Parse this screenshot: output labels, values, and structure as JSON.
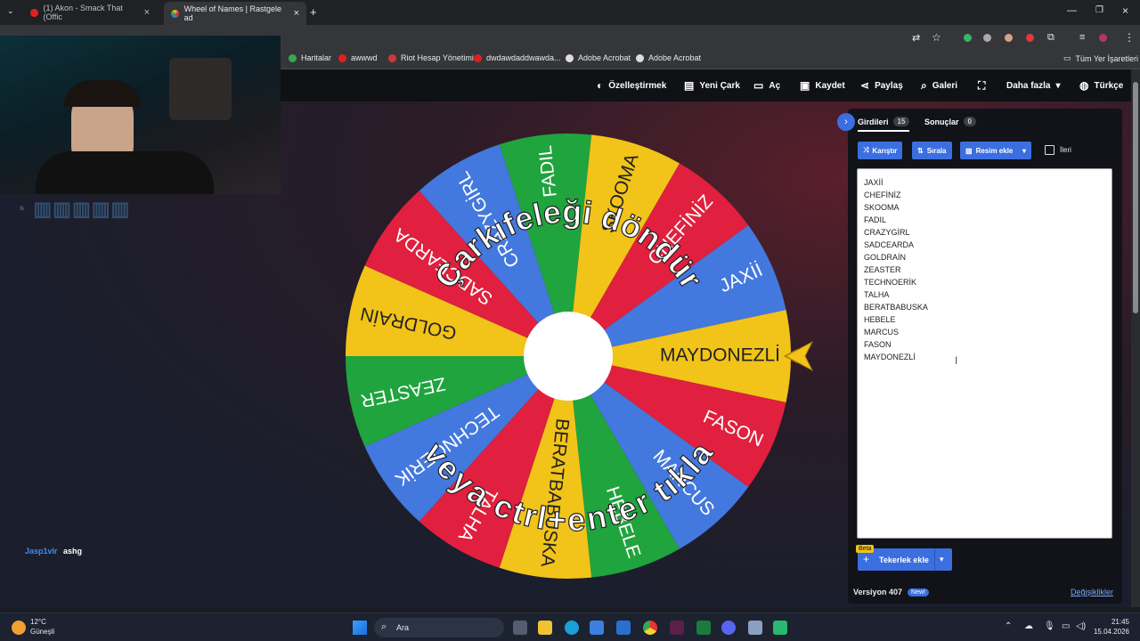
{
  "browser": {
    "tabs": [
      {
        "title": "(1) Akon - Smack That (Offic",
        "active": false
      },
      {
        "title": "Wheel of Names | Rastgele ad",
        "active": true
      }
    ],
    "bookmarks": [
      "Haritalar",
      "awwwd",
      "Riot Hesap Yönetimi",
      "dwdawdaddwawda...",
      "Adobe Acrobat",
      "Adobe Acrobat"
    ],
    "all_bookmarks": "Tüm Yer İşaretleri"
  },
  "nav": {
    "customize": "Özelleştirmek",
    "new_wheel": "Yeni Çark",
    "open": "Aç",
    "save": "Kaydet",
    "share": "Paylaş",
    "gallery": "Galeri",
    "more": "Daha fazla",
    "language": "Türkçe"
  },
  "wheel": {
    "top_text": "Çarkıfeleği döndür",
    "bottom_text": "veya ctrl+enter tıkla",
    "segments": [
      {
        "label": "MAYDONEZLİ",
        "color": "#f2c318"
      },
      {
        "label": "FASON",
        "color": "#e0203e"
      },
      {
        "label": "MARCUS",
        "color": "#4378de"
      },
      {
        "label": "HEBELE",
        "color": "#20a43e"
      },
      {
        "label": "BERATBABUSKA",
        "color": "#f2c318"
      },
      {
        "label": "TALHA",
        "color": "#e0203e"
      },
      {
        "label": "TECHNOERİK",
        "color": "#4378de"
      },
      {
        "label": "ZEASTER",
        "color": "#20a43e"
      },
      {
        "label": "GOLDRAİN",
        "color": "#f2c318"
      },
      {
        "label": "SADCEARDA",
        "color": "#e0203e"
      },
      {
        "label": "CRAZYGİRL",
        "color": "#4378de"
      },
      {
        "label": "FADIL",
        "color": "#20a43e"
      },
      {
        "label": "SKOOMA",
        "color": "#f2c318"
      },
      {
        "label": "CHEFİNİZ",
        "color": "#e0203e"
      },
      {
        "label": "JAXİİ",
        "color": "#4378de"
      }
    ]
  },
  "panel": {
    "entries_tab": "Girdileri",
    "entries_count": "15",
    "results_tab": "Sonuçlar",
    "results_count": "0",
    "shuffle": "Karıştır",
    "sort": "Sırala",
    "add_image": "Resim ekle",
    "advanced": "İleri",
    "entries": [
      "JAXİİ",
      "CHEFİNİZ",
      "SKOOMA",
      "FADIL",
      "CRAZYGİRL",
      "SADCEARDA",
      "GOLDRAİN",
      "ZEASTER",
      "TECHNOERİK",
      "TALHA",
      "BERATBABUSKA",
      "HEBELE",
      "MARCUS",
      "FASON",
      "MAYDONEZLİ"
    ],
    "beta": "Beta",
    "add_wheel": "Tekerlek ekle",
    "version": "Versiyon 407",
    "new_badge": "New!",
    "changes": "Değişiklikler"
  },
  "chat": {
    "user": "Jasp1vlr",
    "message": "ashg"
  },
  "taskbar": {
    "weather_temp": "12°C",
    "weather_desc": "Güneşli",
    "search": "Ara",
    "time": "21:45",
    "date": "15.04.2026"
  },
  "colors": {
    "accent": "#3b6fe0",
    "yellow": "#f2c318",
    "red": "#e0203e",
    "blue": "#4378de",
    "green": "#20a43e"
  }
}
